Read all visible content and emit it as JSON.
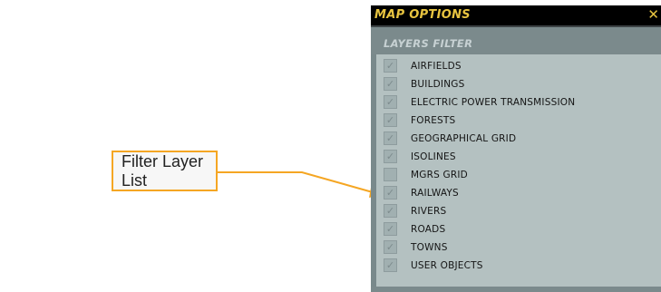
{
  "annotation": {
    "callout_text": "Filter Layer List"
  },
  "window": {
    "title": "MAP OPTIONS",
    "close_glyph": "✕",
    "section_title": "LAYERS FILTER",
    "title_color": "#e8c440",
    "layers": [
      {
        "label": "AIRFIELDS",
        "checked": true
      },
      {
        "label": "BUILDINGS",
        "checked": true
      },
      {
        "label": "ELECTRIC POWER TRANSMISSION",
        "checked": true
      },
      {
        "label": "FORESTS",
        "checked": true
      },
      {
        "label": "GEOGRAPHICAL GRID",
        "checked": true
      },
      {
        "label": "ISOLINES",
        "checked": true
      },
      {
        "label": "MGRS GRID",
        "checked": false
      },
      {
        "label": "RAILWAYS",
        "checked": true
      },
      {
        "label": "RIVERS",
        "checked": true
      },
      {
        "label": "ROADS",
        "checked": true
      },
      {
        "label": "TOWNS",
        "checked": true
      },
      {
        "label": "USER OBJECTS",
        "checked": true
      }
    ]
  }
}
